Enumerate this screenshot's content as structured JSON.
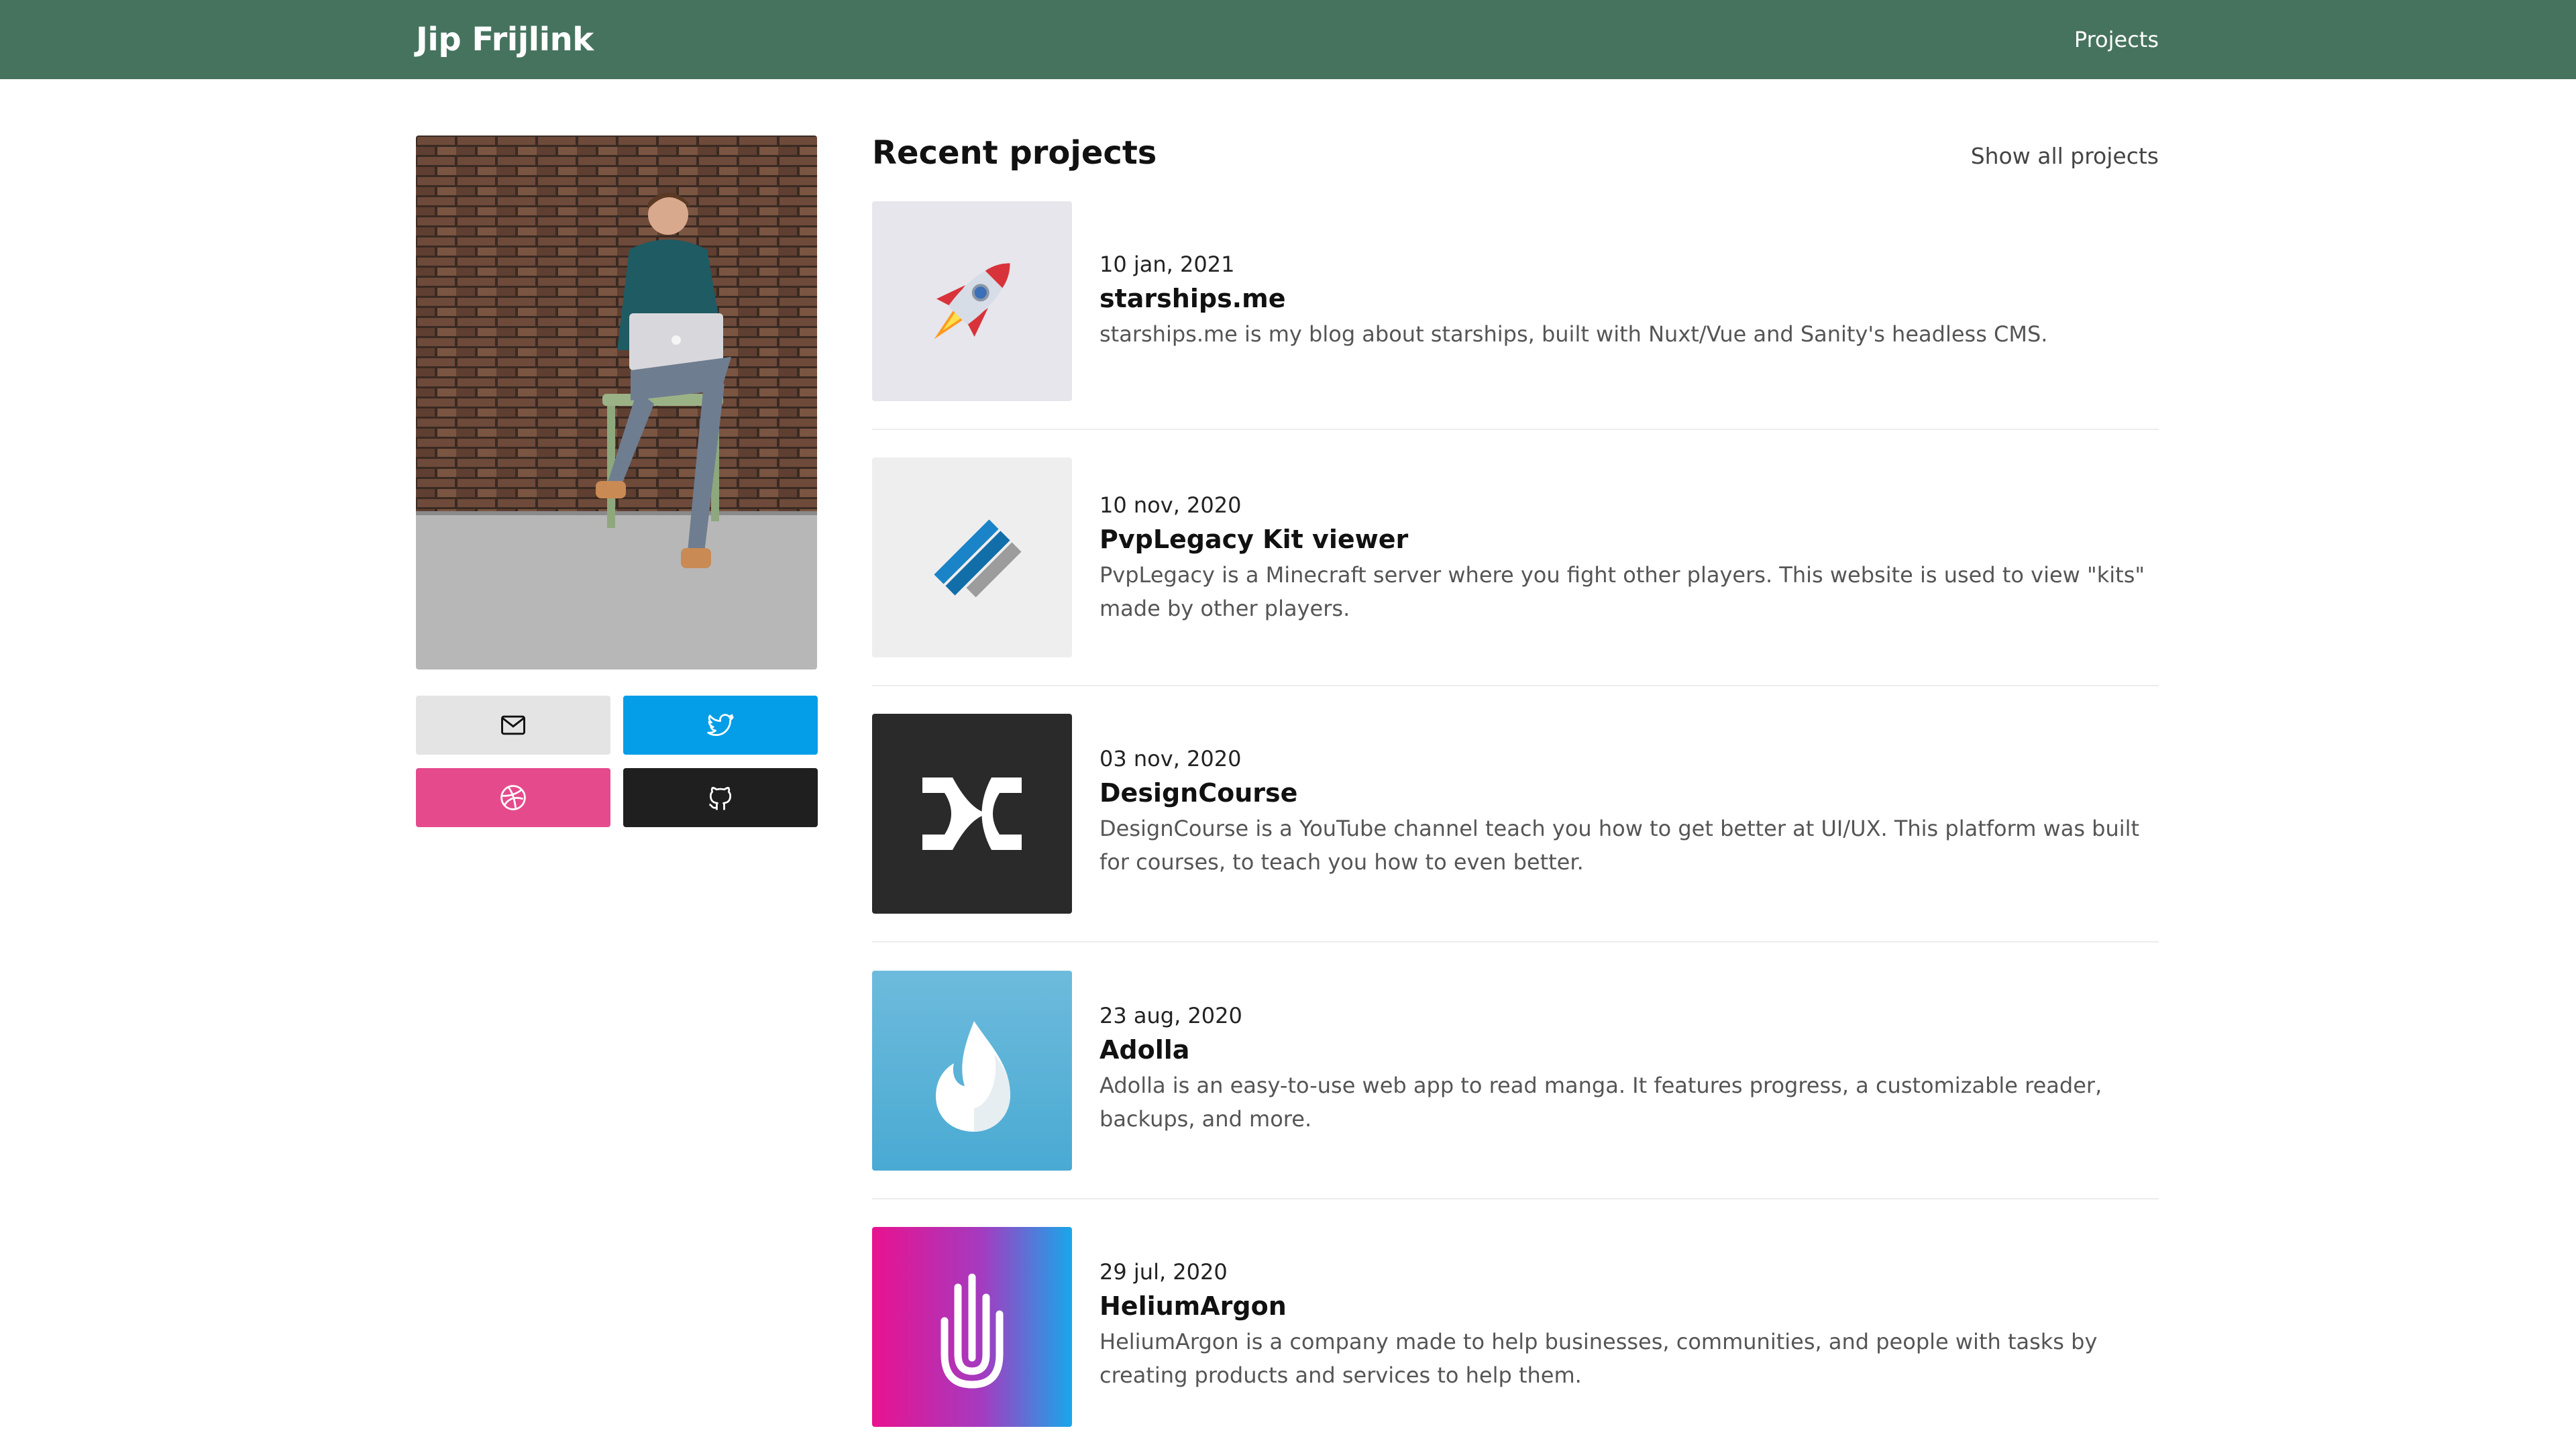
{
  "header": {
    "brand": "Jip Frijlink",
    "nav_projects": "Projects"
  },
  "sidebar": {
    "social_icons": [
      "mail-icon",
      "twitter-icon",
      "dribbble-icon",
      "github-icon"
    ],
    "colors": {
      "mail": "#e4e4e4",
      "twitter": "#049ee8",
      "dribbble": "#e54b8c",
      "github": "#1f1f1f"
    }
  },
  "main": {
    "title": "Recent projects",
    "show_all": "Show all projects",
    "projects": [
      {
        "date": "10 jan, 2021",
        "name": "starships.me",
        "description": "starships.me is my blog about starships, built with Nuxt/Vue and Sanity's headless CMS.",
        "icon": "rocket-icon"
      },
      {
        "date": "10 nov, 2020",
        "name": "PvpLegacy Kit viewer",
        "description": "PvpLegacy is a Minecraft server where you fight other players. This website is used to view \"kits\" made by other players.",
        "icon": "pvplegacy-logo-icon"
      },
      {
        "date": "03 nov, 2020",
        "name": "DesignCourse",
        "description": "DesignCourse is a YouTube channel teach you how to get better at UI/UX. This platform was built for courses, to teach you how to even better.",
        "icon": "designcourse-logo-icon"
      },
      {
        "date": "23 aug, 2020",
        "name": "Adolla",
        "description": "Adolla is an easy-to-use web app to read manga. It features progress, a customizable reader, backups, and more.",
        "icon": "flame-drop-icon"
      },
      {
        "date": "29 jul, 2020",
        "name": "HeliumArgon",
        "description": "HeliumArgon is a company made to help businesses, communities, and people with tasks by creating products and services to help them.",
        "icon": "heliumargon-hand-icon"
      }
    ]
  },
  "colors": {
    "header_bg": "#46735e"
  }
}
